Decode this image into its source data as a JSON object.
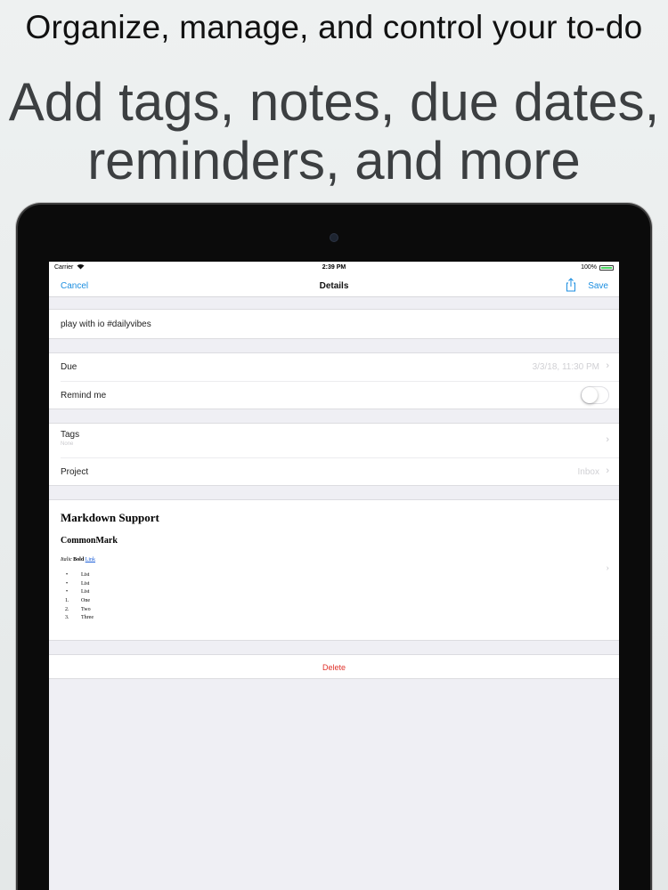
{
  "headline": {
    "line1": "Organize, manage, and control your to-do",
    "line2a": "Add tags, notes, due dates,",
    "line2b": "reminders, and more"
  },
  "statusbar": {
    "carrier": "Carrier",
    "time": "2:39 PM",
    "battery": "100%"
  },
  "navbar": {
    "cancel": "Cancel",
    "title": "Details",
    "save": "Save"
  },
  "task": {
    "title": "play with io #dailyvibes"
  },
  "schedule": {
    "due_label": "Due",
    "due_value": "3/3/18, 11:30 PM",
    "remind_label": "Remind me",
    "remind_on": false
  },
  "meta": {
    "tags_label": "Tags",
    "tags_value": "None",
    "project_label": "Project",
    "project_value": "Inbox"
  },
  "notes": {
    "h1": "Markdown Support",
    "h2": "CommonMark",
    "italic": "Italic",
    "bold": "Bold",
    "link": "Link",
    "bullets": [
      "List",
      "List",
      "List"
    ],
    "numbered": [
      {
        "n": "1.",
        "text": "One"
      },
      {
        "n": "2.",
        "text": "Two"
      },
      {
        "n": "3.",
        "text": "Three"
      }
    ]
  },
  "actions": {
    "delete": "Delete"
  },
  "colors": {
    "accent": "#1b8ee0",
    "destructive": "#e0322b",
    "background": "#efeff4"
  }
}
